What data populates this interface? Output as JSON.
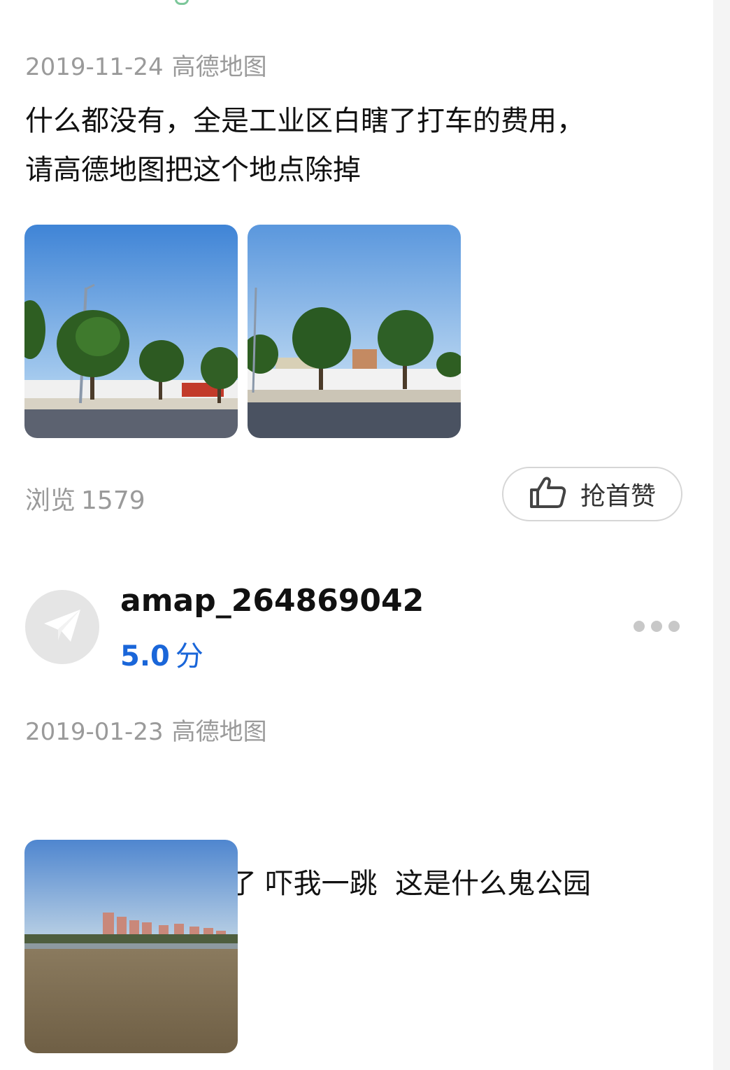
{
  "reviews": [
    {
      "date": "2019-11-24",
      "source": "高德地图",
      "text_lines": [
        "什么都没有，全是工业区白瞎了打车的费用，",
        "请高德地图把这个地点除掉"
      ],
      "photos": [
        "street-trees-photo",
        "street-wall-photo"
      ],
      "views_label": "浏览",
      "views_count": "1579",
      "like_label": "抢首赞"
    },
    {
      "username": "amap_264869042",
      "rating": "5.0",
      "rating_unit": "分",
      "date": "2019-01-23",
      "source": "高德地图",
      "text_lines": [
        "走了 半天   来来了 吓我一跳  这是什么鬼公园"
      ],
      "photos": [
        "river-buildings-photo"
      ]
    }
  ],
  "icons": {
    "like": "thumbs-up-icon",
    "avatar": "paper-plane-icon",
    "more": "more-dots-icon"
  },
  "colors": {
    "rating": "#1a66d9",
    "meta": "#9a9a9a",
    "text": "#111111"
  }
}
